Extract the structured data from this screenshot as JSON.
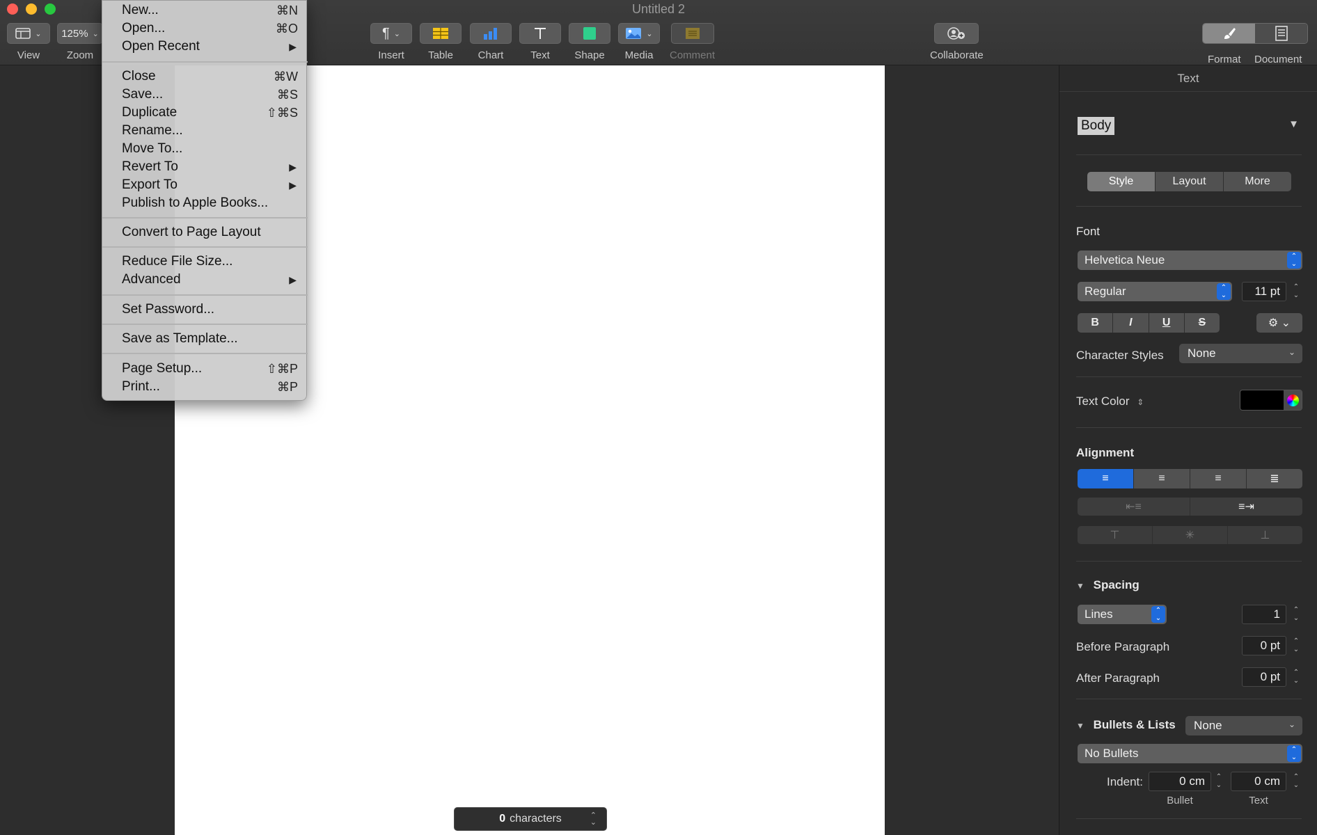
{
  "window": {
    "title": "Untitled 2"
  },
  "toolbar": {
    "view": "View",
    "zoom_value": "125%",
    "zoom": "Zoom",
    "insert": "Insert",
    "table": "Table",
    "chart": "Chart",
    "text": "Text",
    "shape": "Shape",
    "media": "Media",
    "comment": "Comment",
    "collaborate": "Collaborate",
    "format": "Format",
    "document": "Document"
  },
  "file_menu": {
    "items": [
      {
        "label": "New...",
        "shortcut": "⌘N"
      },
      {
        "label": "Open...",
        "shortcut": "⌘O"
      },
      {
        "label": "Open Recent",
        "shortcut": ""
      },
      {
        "label": "Close",
        "shortcut": "⌘W"
      },
      {
        "label": "Save...",
        "shortcut": "⌘S"
      },
      {
        "label": "Duplicate",
        "shortcut": "⇧⌘S"
      },
      {
        "label": "Rename...",
        "shortcut": ""
      },
      {
        "label": "Move To...",
        "shortcut": ""
      },
      {
        "label": "Revert To",
        "shortcut": ""
      },
      {
        "label": "Export To",
        "shortcut": ""
      },
      {
        "label": "Publish to Apple Books...",
        "shortcut": ""
      },
      {
        "label": "Convert to Page Layout",
        "shortcut": ""
      },
      {
        "label": "Reduce File Size...",
        "shortcut": ""
      },
      {
        "label": "Advanced",
        "shortcut": ""
      },
      {
        "label": "Set Password...",
        "shortcut": ""
      },
      {
        "label": "Save as Template...",
        "shortcut": ""
      },
      {
        "label": "Page Setup...",
        "shortcut": "⇧⌘P"
      },
      {
        "label": "Print...",
        "shortcut": "⌘P"
      }
    ]
  },
  "status": {
    "count": "0",
    "unit": "characters"
  },
  "inspector": {
    "header": "Text",
    "paragraph_style": "Body",
    "tabs": [
      "Style",
      "Layout",
      "More"
    ],
    "font_label": "Font",
    "font_family": "Helvetica Neue",
    "font_weight": "Regular",
    "font_size": "11 pt",
    "style_buttons": [
      "B",
      "I",
      "U",
      "S"
    ],
    "character_styles_label": "Character Styles",
    "character_styles_value": "None",
    "text_color_label": "Text Color",
    "text_color": "#000000",
    "alignment_label": "Alignment",
    "spacing_label": "Spacing",
    "spacing_mode": "Lines",
    "spacing_value": "1",
    "before_paragraph_label": "Before Paragraph",
    "before_paragraph_value": "0 pt",
    "after_paragraph_label": "After Paragraph",
    "after_paragraph_value": "0 pt",
    "bullets_label": "Bullets & Lists",
    "bullets_style": "None",
    "bullets_type": "No Bullets",
    "indent_label": "Indent:",
    "indent_bullet_value": "0 cm",
    "indent_text_value": "0 cm",
    "indent_bullet_caption": "Bullet",
    "indent_text_caption": "Text"
  }
}
